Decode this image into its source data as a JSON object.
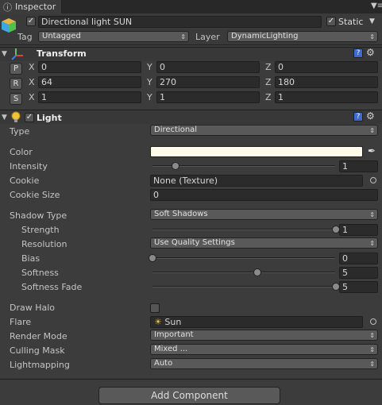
{
  "window": {
    "tab_label": "Inspector",
    "menu_icon": "menu-icon"
  },
  "gameobject": {
    "active": true,
    "name": "Directional light SUN",
    "static_checked": true,
    "static_label": "Static",
    "tag_label": "Tag",
    "tag_value": "Untagged",
    "layer_label": "Layer",
    "layer_value": "DynamicLighting"
  },
  "transform": {
    "title": "Transform",
    "position": {
      "btn": "P",
      "x": "0",
      "y": "0",
      "z": "0"
    },
    "rotation": {
      "btn": "R",
      "x": "64",
      "y": "270",
      "z": "180"
    },
    "scale": {
      "btn": "S",
      "x": "1",
      "y": "1",
      "z": "1"
    },
    "axis_x": "X",
    "axis_y": "Y",
    "axis_z": "Z"
  },
  "light": {
    "title": "Light",
    "enabled": true,
    "props": {
      "type_label": "Type",
      "type_value": "Directional",
      "color_label": "Color",
      "color_value": "#fffbe8",
      "intensity_label": "Intensity",
      "intensity_value": "1",
      "intensity_fraction": 0.125,
      "cookie_label": "Cookie",
      "cookie_value": "None (Texture)",
      "cookie_size_label": "Cookie Size",
      "cookie_size_value": "0",
      "shadow_type_label": "Shadow Type",
      "shadow_type_value": "Soft Shadows",
      "strength_label": "Strength",
      "strength_value": "1",
      "strength_fraction": 1.0,
      "resolution_label": "Resolution",
      "resolution_value": "Use Quality Settings",
      "bias_label": "Bias",
      "bias_value": "0",
      "bias_fraction": 0.0,
      "softness_label": "Softness",
      "softness_value": "5",
      "softness_fraction": 0.57,
      "softness_fade_label": "Softness Fade",
      "softness_fade_value": "5",
      "softness_fade_fraction": 1.0,
      "draw_halo_label": "Draw Halo",
      "draw_halo_checked": false,
      "flare_label": "Flare",
      "flare_value": "Sun",
      "render_mode_label": "Render Mode",
      "render_mode_value": "Important",
      "culling_mask_label": "Culling Mask",
      "culling_mask_value": "Mixed ...",
      "lightmapping_label": "Lightmapping",
      "lightmapping_value": "Auto"
    }
  },
  "footer": {
    "add_component_label": "Add Component"
  }
}
